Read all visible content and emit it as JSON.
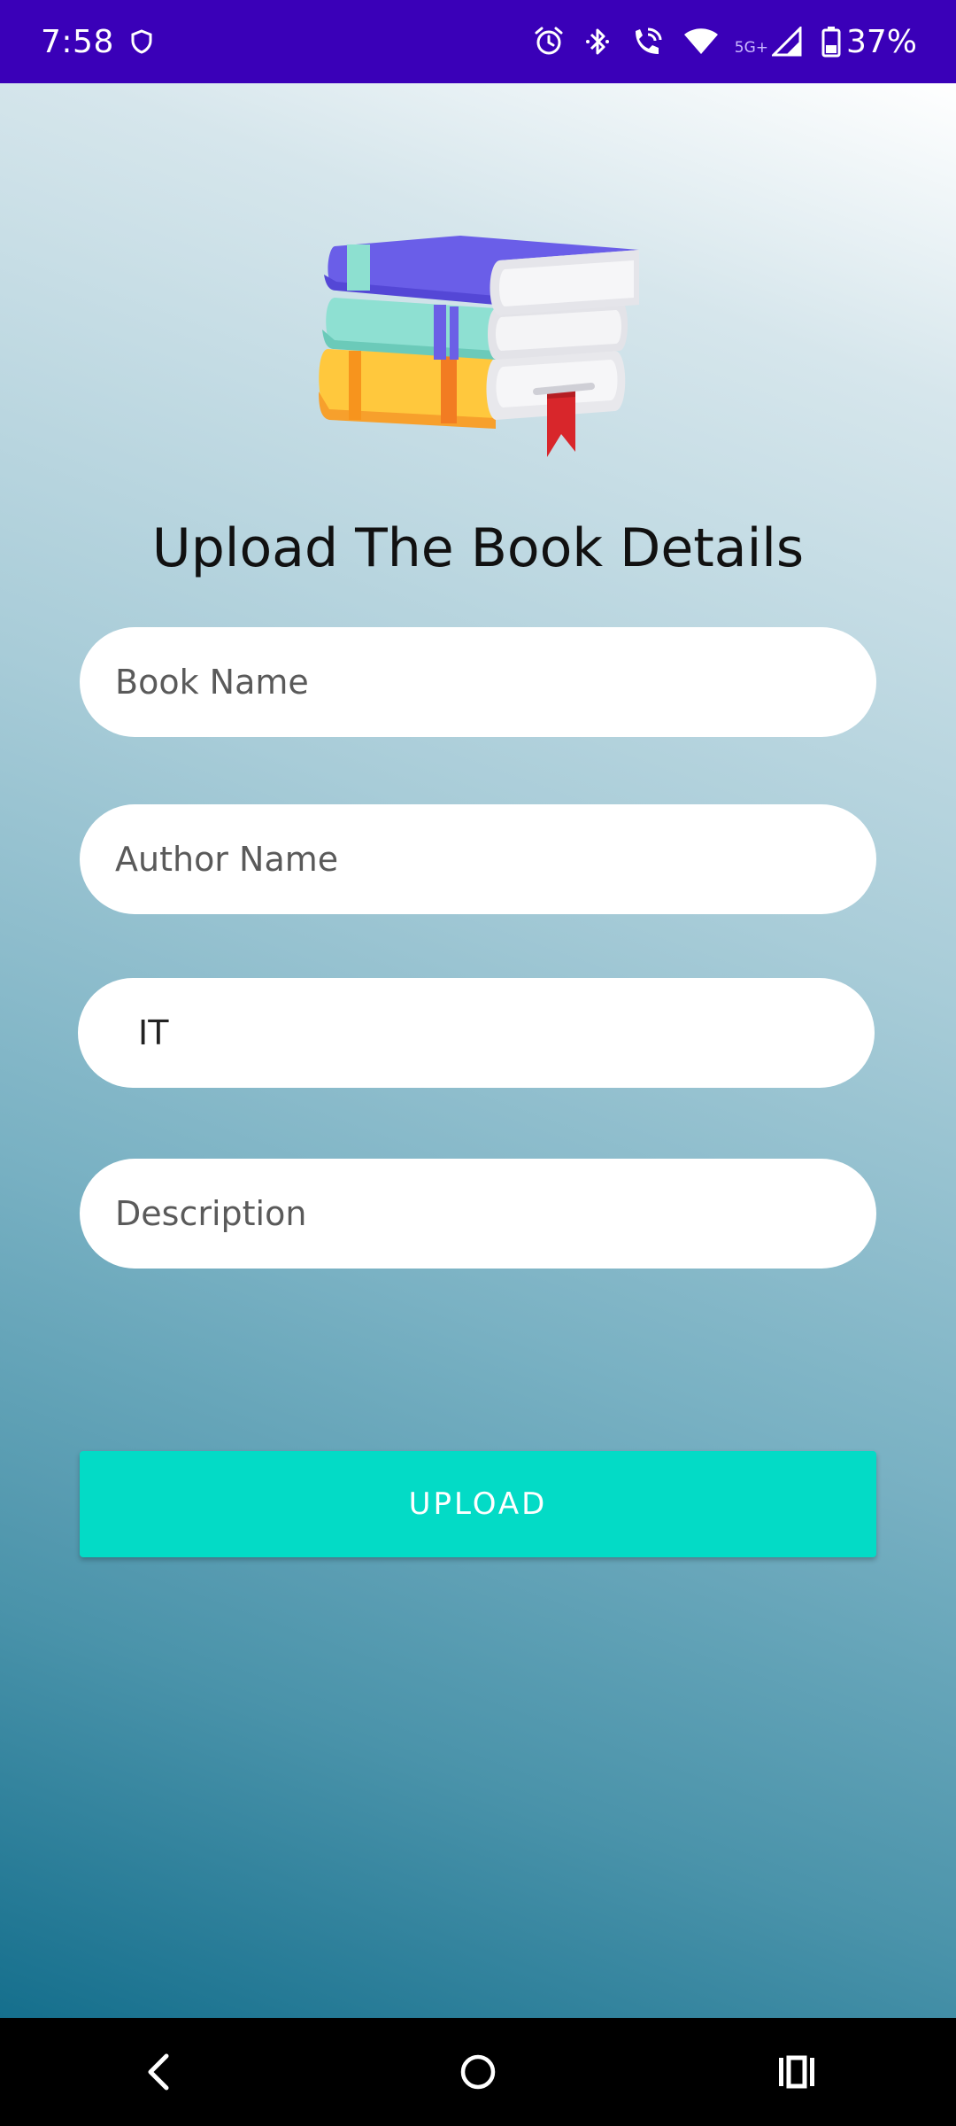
{
  "status_bar": {
    "time": "7:58",
    "network_label": "5G+",
    "battery_percent": "37%"
  },
  "page": {
    "title": "Upload The Book Details"
  },
  "form": {
    "book_name_placeholder": "Book Name",
    "author_name_placeholder": "Author Name",
    "category_value": "IT",
    "description_placeholder": "Description",
    "upload_label": "UPLOAD"
  },
  "icons": {
    "status_left": [
      "shield-icon"
    ],
    "status_right": [
      "alarm-icon",
      "bluetooth-icon",
      "wifi-calling-icon",
      "wifi-icon",
      "signal-icon",
      "battery-icon"
    ],
    "navigation": [
      "back-icon",
      "home-icon",
      "recents-icon"
    ],
    "illustration": "books-stack-illustration"
  },
  "colors": {
    "status_bar": "#3a00b8",
    "upload_button": "#03dbc6",
    "bookmark": "#d8262b"
  }
}
